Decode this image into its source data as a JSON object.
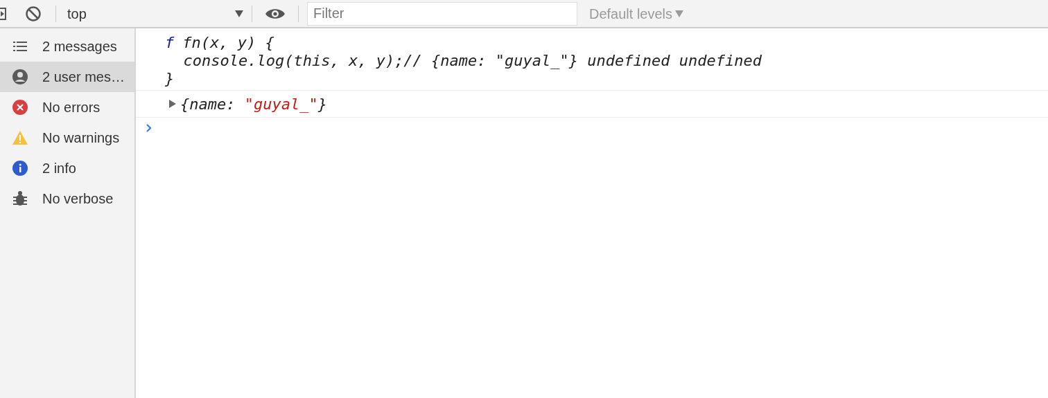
{
  "toolbar": {
    "context": "top",
    "filter": {
      "placeholder": "Filter"
    },
    "levels": "Default levels"
  },
  "sidebar": {
    "items": [
      {
        "kind": "list",
        "label": "2 messages",
        "selected": false
      },
      {
        "kind": "user",
        "label": "2 user mes…",
        "selected": true
      },
      {
        "kind": "error",
        "label": "No errors",
        "selected": false
      },
      {
        "kind": "warning",
        "label": "No warnings",
        "selected": false
      },
      {
        "kind": "info",
        "label": "2 info",
        "selected": false
      },
      {
        "kind": "verbose",
        "label": "No verbose",
        "selected": false
      }
    ]
  },
  "console": {
    "messages": [
      {
        "kind": "function",
        "keyword": "f",
        "lines": [
          "fn(x, y) {",
          "  console.log(this, x, y);// {name: \"guyal_\"} undefined undefined",
          "}"
        ]
      },
      {
        "kind": "object",
        "expanded": false,
        "prefix": "{name: ",
        "value": "\"guyal_\"",
        "suffix": "}"
      }
    ]
  }
}
